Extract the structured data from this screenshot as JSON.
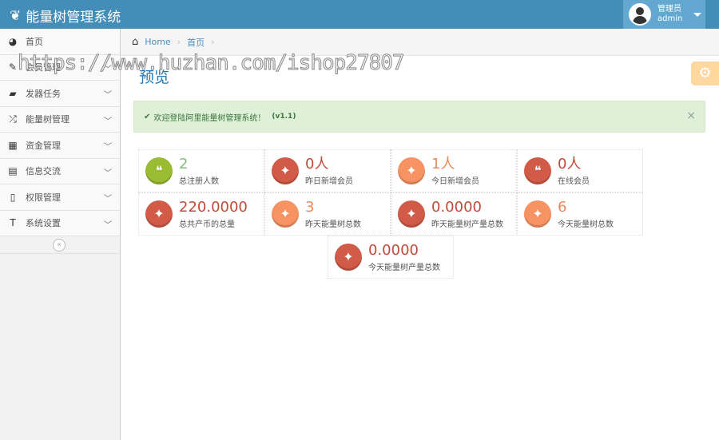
{
  "header": {
    "title": "能量树管理系统",
    "user_role": "管理员",
    "user_name": "admin"
  },
  "sidebar": {
    "items": [
      {
        "label": "首页",
        "icon": "dashboard-icon",
        "glyph": "◕",
        "chev": false
      },
      {
        "label": "会员管理",
        "icon": "edit-icon",
        "glyph": "✎",
        "chev": true
      },
      {
        "label": "发器任务",
        "icon": "book-icon",
        "glyph": "▰",
        "chev": true
      },
      {
        "label": "能量树管理",
        "icon": "shuffle-icon",
        "glyph": "⤮",
        "chev": true
      },
      {
        "label": "资金管理",
        "icon": "calendar-icon",
        "glyph": "▦",
        "chev": true
      },
      {
        "label": "信息交流",
        "icon": "list-icon",
        "glyph": "▤",
        "chev": true
      },
      {
        "label": "权限管理",
        "icon": "file-icon",
        "glyph": "▯",
        "chev": true
      },
      {
        "label": "系统设置",
        "icon": "text-icon",
        "glyph": "T",
        "chev": true
      }
    ]
  },
  "breadcrumb": {
    "home": "Home",
    "current": "首页"
  },
  "page_title": "预览",
  "alert": {
    "text": "欢迎登陆阿里能量树管理系统！",
    "version": "(v1.1)"
  },
  "stats": [
    {
      "value": "2",
      "label": "总注册人数",
      "color": "#9abc32",
      "vcolor": "#87b87f",
      "glyph": "💬"
    },
    {
      "value": "0人",
      "label": "昨日新增会员",
      "color": "#d15b47",
      "vcolor": "#c24a3a",
      "glyph": "🐦"
    },
    {
      "value": "1人",
      "label": "今日新增会员",
      "color": "#f79263",
      "vcolor": "#e98a5e",
      "glyph": "🐦"
    },
    {
      "value": "0人",
      "label": "在线会员",
      "color": "#d15b47",
      "vcolor": "#c24a3a",
      "glyph": "💬"
    },
    {
      "value": "220.0000",
      "label": "总共产币的总量",
      "color": "#d15b47",
      "vcolor": "#c24a3a",
      "glyph": "🐦"
    },
    {
      "value": "3",
      "label": "昨天能量树总数",
      "color": "#f79263",
      "vcolor": "#e98a5e",
      "glyph": "🐦"
    },
    {
      "value": "0.0000",
      "label": "昨天能量树产量总数",
      "color": "#d15b47",
      "vcolor": "#c24a3a",
      "glyph": "🐦"
    },
    {
      "value": "6",
      "label": "今天能量树总数",
      "color": "#f79263",
      "vcolor": "#e98a5e",
      "glyph": "🐦"
    },
    {
      "value": "0.0000",
      "label": "今天能量树产量总数",
      "color": "#d15b47",
      "vcolor": "#c24a3a",
      "glyph": "🐦"
    }
  ],
  "watermark": "https://www.huzhan.com/ishop27807"
}
